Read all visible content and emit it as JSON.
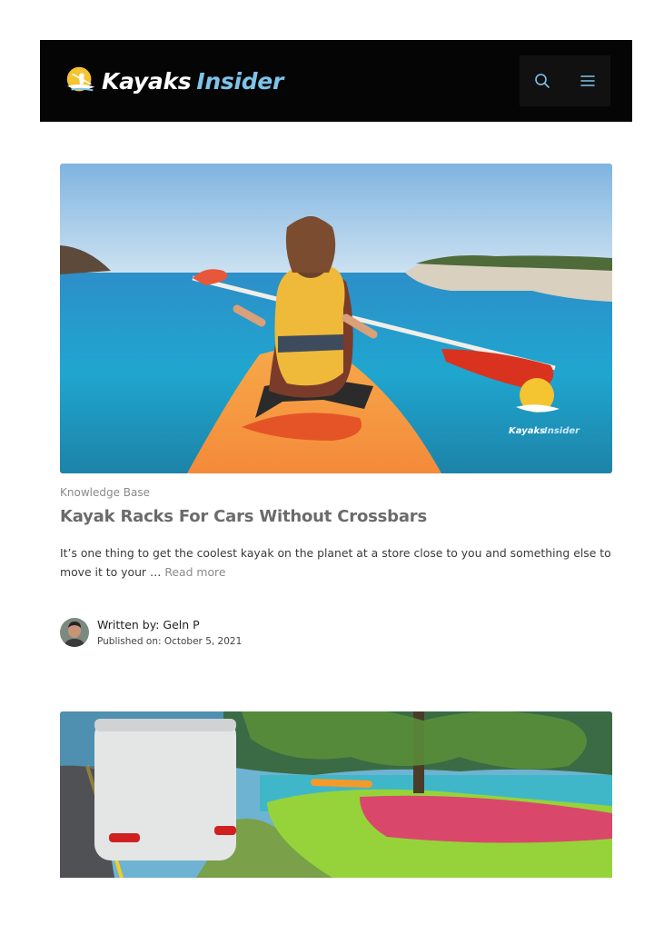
{
  "header": {
    "logo_word1": "Kayaks",
    "logo_word2": "Insider",
    "search_icon": "search-icon",
    "menu_icon": "hamburger-menu-icon"
  },
  "post1": {
    "image_watermark_line1": "Kayaks",
    "image_watermark_line2": "Insider",
    "category": "Knowledge Base",
    "title": "Kayak Racks For Cars Without Crossbars",
    "excerpt": "It’s one thing to get the coolest kayak on the planet at a store close to you and something else to move it to your …",
    "read_more": "Read more",
    "written_by": "Written by: Geln P",
    "published_on": "Published on: October 5, 2021"
  },
  "colors": {
    "header_bg": "#050505",
    "logo_accent": "#7ec3ea",
    "title": "#6b6b6b",
    "muted": "#8a8a8a"
  }
}
